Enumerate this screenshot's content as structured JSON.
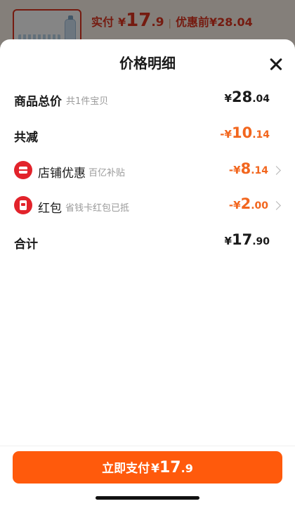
{
  "top_bar": {
    "paid_label": "实付",
    "paid_currency": "¥",
    "paid_integer": "17",
    "paid_decimal": ".9",
    "separator": "|",
    "before_discount": "优惠前¥28.04"
  },
  "sheet": {
    "title": "价格明细",
    "close_icon": "close-icon"
  },
  "rows": {
    "total": {
      "label": "商品总价",
      "sub": "共1件宝贝",
      "prefix": "¥",
      "integer": "28",
      "decimal": ".04"
    },
    "reduction": {
      "label": "共减",
      "prefix": "-¥",
      "integer": "10",
      "decimal": ".14"
    },
    "shop_discount": {
      "icon": "shop-icon",
      "label": "店铺优惠",
      "sub": "百亿补贴",
      "prefix": "-¥",
      "integer": "8",
      "decimal": ".14"
    },
    "red_packet": {
      "icon": "red-packet-icon",
      "label": "红包",
      "sub": "省钱卡红包已抵",
      "prefix": "-¥",
      "integer": "2",
      "decimal": ".00"
    },
    "sum": {
      "label": "合计",
      "prefix": "¥",
      "integer": "17",
      "decimal": ".90"
    }
  },
  "pay_button": {
    "label": "立即支付",
    "currency": "¥",
    "integer": "17",
    "decimal": ".9"
  },
  "colors": {
    "accent_orange": "#f2661e",
    "button_orange": "#ff5a0c",
    "brand_red": "#e2232b"
  }
}
